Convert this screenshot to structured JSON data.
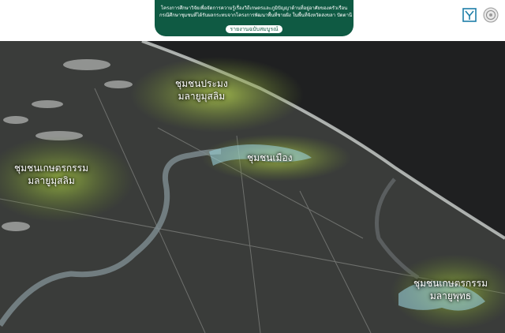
{
  "header": {
    "project_line1": "โครงการศึกษาวิจัยเพื่อจัดการความรู้เรื่องวิถีเกษตรและภูมิปัญญาด้านที่อยู่อาศัยของครัวเรือน",
    "project_line2": "กรณีศึกษาชุมชนที่ได้รับผลกระทบจากโครงการพัฒนาพื้นที่ชายฝั่ง ในพื้นที่จังหวัดสงขลา ปัตตานี และนราธิวาส",
    "report_button": "รายงานฉบับสมบูรณ์",
    "logo_left_icon": "institute-logo-icon",
    "logo_right_icon": "emblem-seal-icon"
  },
  "map": {
    "areas": [
      {
        "line1": "ชุมชนประมง",
        "line2": "มลายูมุสลิม"
      },
      {
        "line1": "ชุมชนเกษตรกรรม",
        "line2": "มลายูมุสลิม"
      },
      {
        "line1": "ชุมชนเมือง",
        "line2": ""
      },
      {
        "line1": "ชุมชนเกษตรกรรม",
        "line2": "มลายูพุทธ"
      }
    ]
  },
  "colors": {
    "header_green": "#0f5a43",
    "highlight_green": "#8aa83a",
    "river_blue": "#9fd8e8",
    "sea": "#1f2021",
    "land": "#3a3c3a"
  }
}
